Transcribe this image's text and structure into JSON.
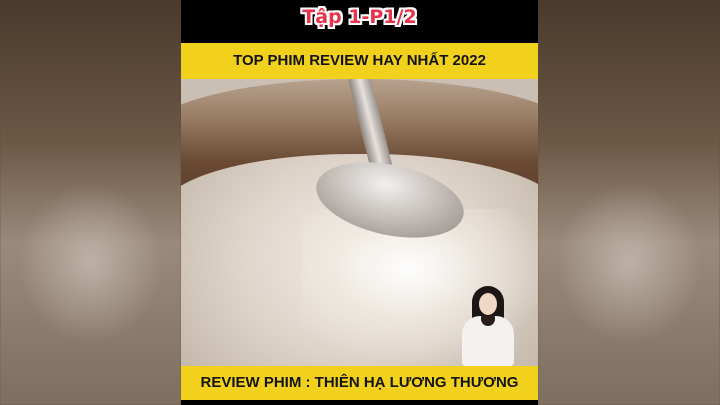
{
  "video": {
    "episode_label": "Tập 1-P1/2",
    "top_banner": "TOP PHIM REVIEW HAY NHẤT 2022",
    "bottom_banner": "REVIEW PHIM : THIÊN HẠ LƯƠNG THƯƠNG"
  },
  "colors": {
    "banner": "#f1d11c",
    "episode_text": "#e8334a",
    "frame": "#000000"
  }
}
